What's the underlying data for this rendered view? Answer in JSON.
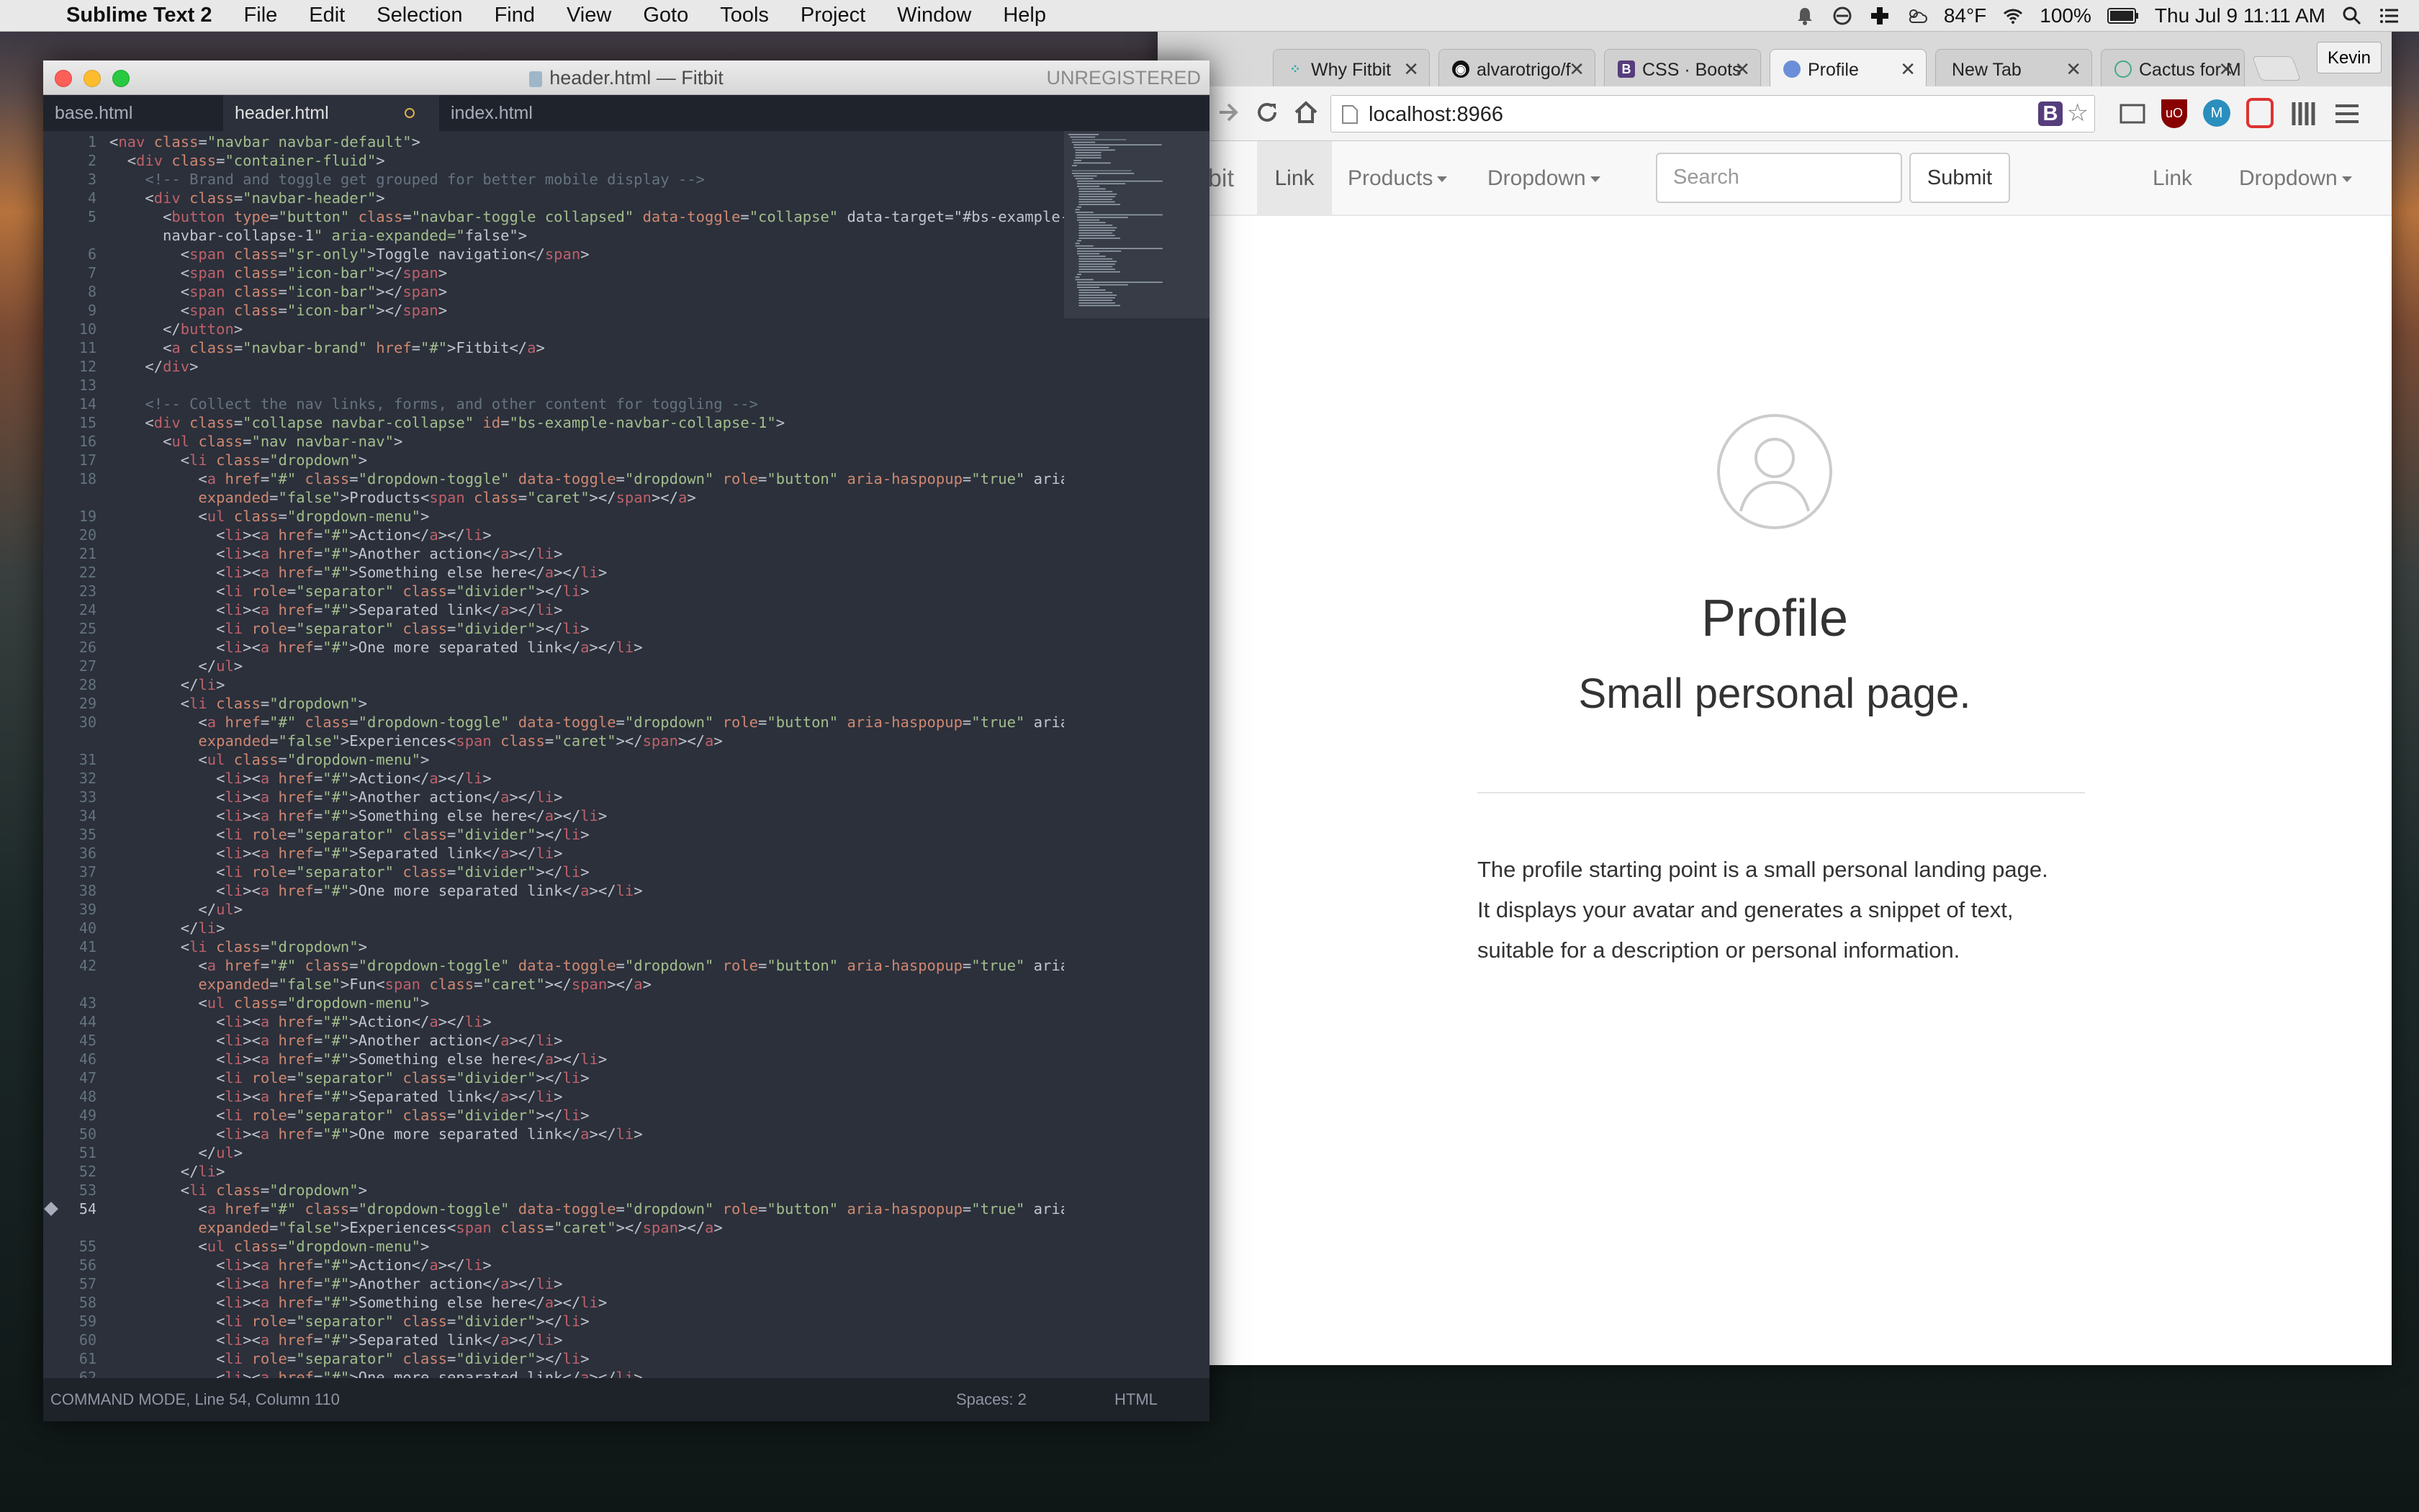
{
  "menubar": {
    "app": "Sublime Text 2",
    "items": [
      "File",
      "Edit",
      "Selection",
      "Find",
      "View",
      "Goto",
      "Tools",
      "Project",
      "Window",
      "Help"
    ],
    "weather": "84°F",
    "battery": "100%",
    "datetime": "Thu Jul 9  11:11 AM"
  },
  "sublime": {
    "title": "header.html — Fitbit",
    "unregistered": "UNREGISTERED",
    "tabs": [
      "base.html",
      "header.html",
      "index.html"
    ],
    "status_left": "COMMAND MODE, Line 54, Column 110",
    "spaces": "Spaces: 2",
    "syntax": "HTML"
  },
  "browser": {
    "tabs": [
      {
        "label": "Why Fitbit",
        "icon": "fitbit-icon"
      },
      {
        "label": "alvarotrigo/f",
        "icon": "github-icon"
      },
      {
        "label": "CSS · Boots",
        "icon": "bootstrap-icon"
      },
      {
        "label": "Profile",
        "icon": "globe-icon"
      },
      {
        "label": "New Tab",
        "icon": ""
      },
      {
        "label": "Cactus for M",
        "icon": "cactus-icon"
      }
    ],
    "user": "Kevin",
    "url": "localhost:8966",
    "page": {
      "navbar": {
        "brand_fragment": "bit",
        "link_active": "Link",
        "products": "Products",
        "dropdown": "Dropdown",
        "search_placeholder": "Search",
        "submit": "Submit",
        "right_link": "Link",
        "right_dropdown": "Dropdown"
      },
      "title": "Profile",
      "subtitle": "Small personal page.",
      "body": [
        "The profile starting point is a small personal landing page.",
        "It displays your avatar and generates a snippet of text,",
        "suitable for a description or personal information."
      ]
    }
  }
}
